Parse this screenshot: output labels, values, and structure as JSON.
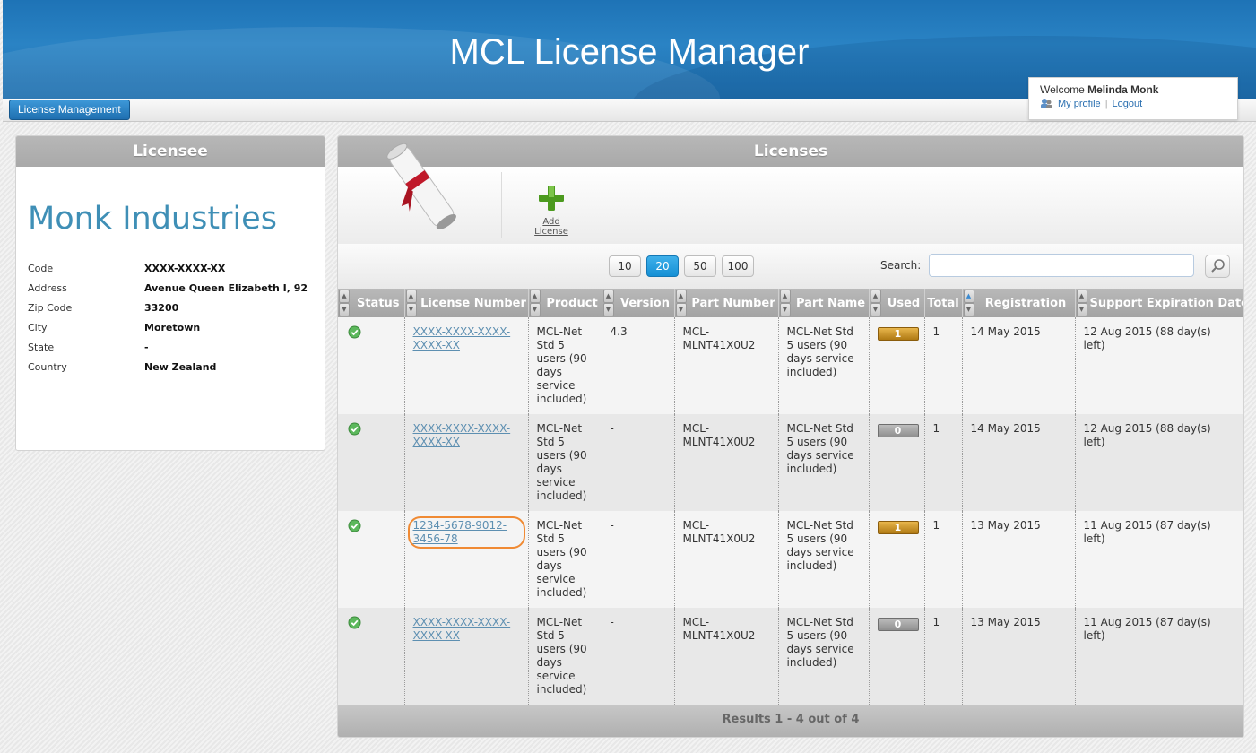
{
  "header": {
    "title": "MCL License Manager"
  },
  "nav": {
    "tab_label": "License Management"
  },
  "user": {
    "welcome_prefix": "Welcome",
    "name": "Melinda Monk",
    "profile_link": "My profile",
    "logout_link": "Logout"
  },
  "licensee": {
    "panel_title": "Licensee",
    "company": "Monk Industries",
    "fields": [
      {
        "label": "Code",
        "value": "XXXX-XXXX-XX"
      },
      {
        "label": "Address",
        "value": "Avenue Queen Elizabeth I, 92"
      },
      {
        "label": "Zip Code",
        "value": "33200"
      },
      {
        "label": "City",
        "value": "Moretown"
      },
      {
        "label": "State",
        "value": "-"
      },
      {
        "label": "Country",
        "value": "New Zealand"
      }
    ]
  },
  "licenses": {
    "panel_title": "Licenses",
    "add_label": "Add License",
    "page_sizes": [
      "10",
      "20",
      "50",
      "100"
    ],
    "active_page_size": "20",
    "search_label": "Search:",
    "search_value": "",
    "columns": [
      "Status",
      "License Number",
      "Product",
      "Version",
      "Part Number",
      "Part Name",
      "Used",
      "Total",
      "Registration",
      "Support Expiration Date"
    ],
    "rows": [
      {
        "license": "XXXX-XXXX-XXXX-XXXX-XX",
        "product": "MCL-Net Std 5 users (90 days service included)",
        "version": "4.3",
        "part_number": "MCL-MLNT41X0U2",
        "part_name": "MCL-Net Std 5 users (90 days service included)",
        "used": "1",
        "total": "1",
        "registration": "14 May 2015",
        "expiration": "12 Aug 2015 (88 day(s) left)"
      },
      {
        "license": "XXXX-XXXX-XXXX-XXXX-XX",
        "product": "MCL-Net Std 5 users (90 days service included)",
        "version": "-",
        "part_number": "MCL-MLNT41X0U2",
        "part_name": "MCL-Net Std 5 users (90 days service included)",
        "used": "0",
        "total": "1",
        "registration": "14 May 2015",
        "expiration": "12 Aug 2015 (88 day(s) left)"
      },
      {
        "license": "1234-5678-9012-3456-78",
        "product": "MCL-Net Std 5 users (90 days service included)",
        "version": "-",
        "part_number": "MCL-MLNT41X0U2",
        "part_name": "MCL-Net Std 5 users (90 days service included)",
        "used": "1",
        "total": "1",
        "registration": "13 May 2015",
        "expiration": "11 Aug 2015 (87 day(s) left)"
      },
      {
        "license": "XXXX-XXXX-XXXX-XXXX-XX",
        "product": "MCL-Net Std 5 users (90 days service included)",
        "version": "-",
        "part_number": "MCL-MLNT41X0U2",
        "part_name": "MCL-Net Std 5 users (90 days service included)",
        "used": "0",
        "total": "1",
        "registration": "13 May 2015",
        "expiration": "11 Aug 2015 (87 day(s) left)"
      }
    ],
    "results_text": "Results 1 - 4 out of 4"
  },
  "colors": {
    "header_blue": "#1e73b6",
    "accent_link": "#5d8fb1",
    "company_color": "#3f8fb6",
    "used_badge": "#c99a2e",
    "unused_badge": "#9e9e9e",
    "highlight_ring": "#f08a33"
  }
}
